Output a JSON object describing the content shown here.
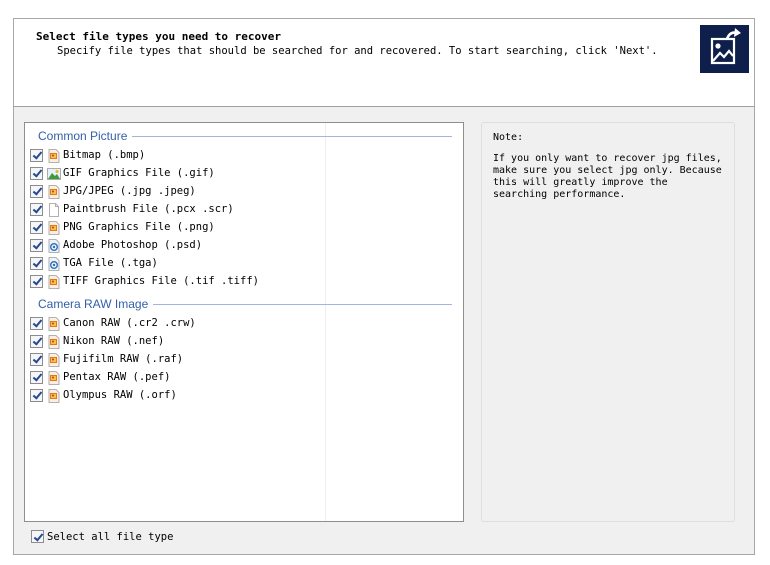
{
  "header": {
    "title": "Select file types you need to recover",
    "subtitle": "Specify file types that should be searched for and recovered. To start searching, click 'Next'."
  },
  "groups": [
    {
      "title": "Common Picture",
      "items": [
        {
          "label": "Bitmap (.bmp)",
          "icon": "image-file-icon",
          "checked": true
        },
        {
          "label": "GIF Graphics File (.gif)",
          "icon": "gif-file-icon",
          "checked": true
        },
        {
          "label": "JPG/JPEG (.jpg .jpeg)",
          "icon": "image-file-icon",
          "checked": true
        },
        {
          "label": "Paintbrush File (.pcx .scr)",
          "icon": "blank-file-icon",
          "checked": true
        },
        {
          "label": "PNG Graphics File (.png)",
          "icon": "image-file-icon",
          "checked": true
        },
        {
          "label": "Adobe Photoshop (.psd)",
          "icon": "photoshop-file-icon",
          "checked": true
        },
        {
          "label": "TGA File (.tga)",
          "icon": "photoshop-file-icon",
          "checked": true
        },
        {
          "label": "TIFF Graphics File (.tif .tiff)",
          "icon": "image-file-icon",
          "checked": true
        }
      ]
    },
    {
      "title": "Camera RAW Image",
      "items": [
        {
          "label": "Canon RAW (.cr2 .crw)",
          "icon": "image-file-icon",
          "checked": true
        },
        {
          "label": "Nikon RAW (.nef)",
          "icon": "image-file-icon",
          "checked": true
        },
        {
          "label": "Fujifilm RAW (.raf)",
          "icon": "image-file-icon",
          "checked": true
        },
        {
          "label": "Pentax RAW (.pef)",
          "icon": "image-file-icon",
          "checked": true
        },
        {
          "label": "Olympus RAW (.orf)",
          "icon": "image-file-icon",
          "checked": true
        }
      ]
    }
  ],
  "note": {
    "title": "Note:",
    "text": "If you only want to recover jpg files,\nmake sure you select jpg only. Because\nthis will greatly improve the\nsearching performance."
  },
  "select_all": {
    "label": "Select all file type",
    "checked": true
  },
  "colors": {
    "accent": "#3360a8",
    "header_icon_bg": "#0d1f4a",
    "check": "#274a8c"
  }
}
